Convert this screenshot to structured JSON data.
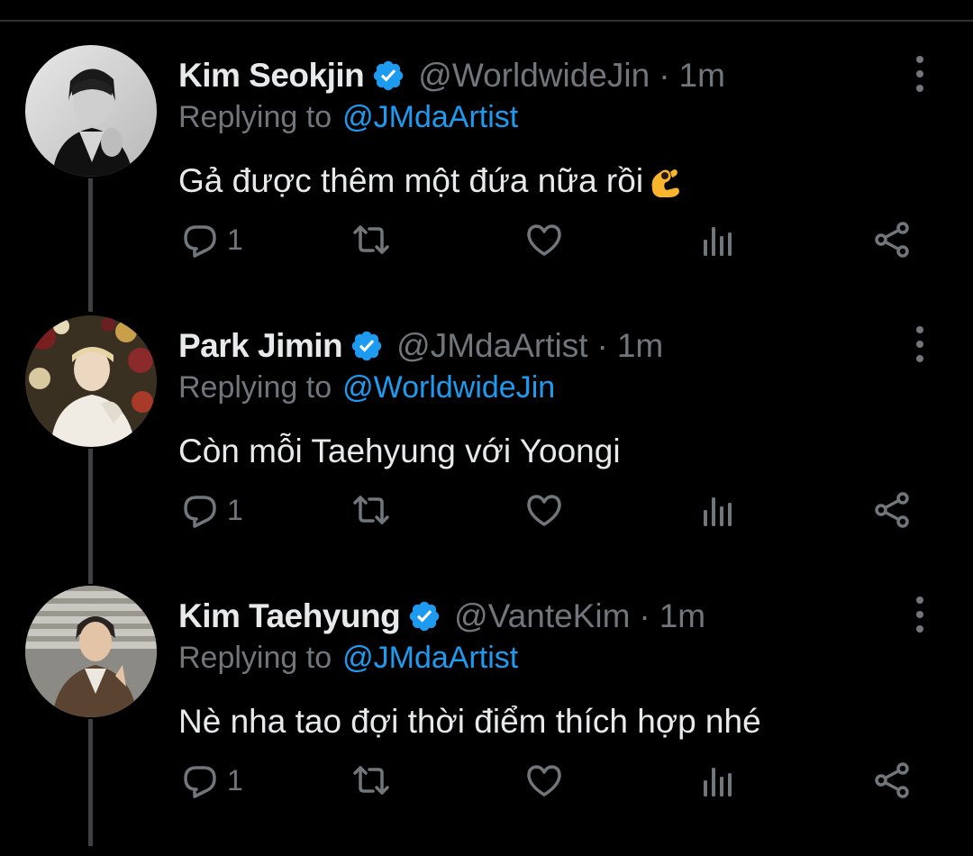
{
  "icons": {
    "verified": "verified-badge-icon",
    "reply": "reply-icon",
    "retweet": "retweet-icon",
    "like": "heart-icon",
    "analytics": "analytics-icon",
    "share": "share-icon",
    "more": "more-vertical-icon",
    "emoji": "ok-hand-emoji"
  },
  "colors": {
    "background": "#000000",
    "text": "#e7e9ea",
    "muted": "#71767b",
    "accent": "#1d9bf0",
    "thread_line": "#3e4144"
  },
  "tweets": [
    {
      "name": "Kim Seokjin",
      "handle": "@WorldwideJin",
      "separator": "·",
      "time": "1m",
      "replying_prefix": "Replying to",
      "replying_to": "@JMdaArtist",
      "text": "Gả được thêm một đứa nữa rồi",
      "reply_count": "1"
    },
    {
      "name": "Park Jimin",
      "handle": "@JMdaArtist",
      "separator": "·",
      "time": "1m",
      "replying_prefix": "Replying to",
      "replying_to": "@WorldwideJin",
      "text": "Còn mỗi Taehyung với Yoongi",
      "reply_count": "1"
    },
    {
      "name": "Kim Taehyung",
      "handle": "@VanteKim",
      "separator": "·",
      "time": "1m",
      "replying_prefix": "Replying to",
      "replying_to": "@JMdaArtist",
      "text": "Nè nha tao đợi thời điểm thích hợp nhé",
      "reply_count": "1"
    }
  ]
}
